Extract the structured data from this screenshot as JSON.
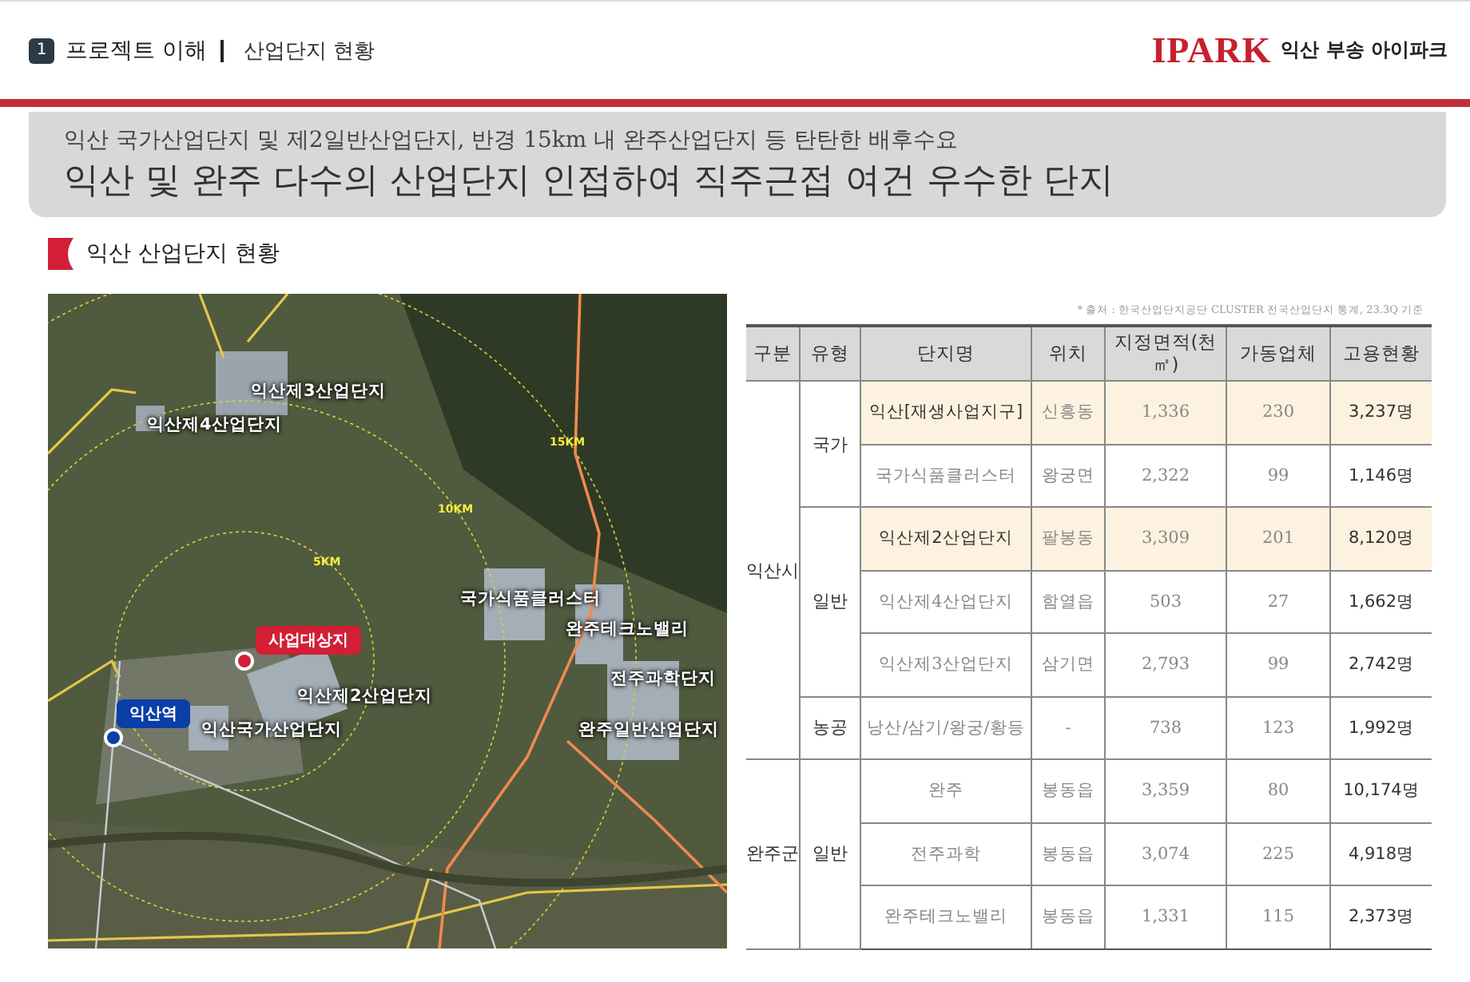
{
  "header": {
    "section_number": "1",
    "section": "프로젝트 이해",
    "page": "산업단지 현황",
    "logo": "IPARK",
    "brand": "익산 부송 아이파크"
  },
  "banner": {
    "subtitle": "익산 국가산업단지 및 제2일반산업단지, 반경 15km 내 완주산업단지 등 탄탄한 배후수요",
    "title": "익산 및 완주 다수의 산업단지 인접하여 직주근접 여건 우수한 단지"
  },
  "section_heading": "익산 산업단지 현황",
  "map": {
    "rings": [
      {
        "label": "5KM"
      },
      {
        "label": "10KM"
      },
      {
        "label": "15KM"
      }
    ],
    "labels": [
      {
        "text": "익산제3산업단지",
        "kind": "area"
      },
      {
        "text": "익산제4산업단지",
        "kind": "area"
      },
      {
        "text": "국가식품클러스터",
        "kind": "area"
      },
      {
        "text": "사업대상지",
        "kind": "site"
      },
      {
        "text": "완주테크노밸리",
        "kind": "area"
      },
      {
        "text": "전주과학단지",
        "kind": "area"
      },
      {
        "text": "익산제2산업단지",
        "kind": "area"
      },
      {
        "text": "익산역",
        "kind": "station"
      },
      {
        "text": "익산국가산업단지",
        "kind": "area"
      },
      {
        "text": "완주일반산업단지",
        "kind": "area"
      }
    ]
  },
  "table": {
    "source": "* 출처 : 한국산업단지공단 CLUSTER 전국산업단지 통계, 23.3Q 기준",
    "columns": [
      "구분",
      "유형",
      "단지명",
      "위치",
      "지정면적(천㎡)",
      "가동업체",
      "고용현황"
    ],
    "groups": [
      {
        "region": "익산시",
        "types": [
          {
            "type": "국가",
            "rows": [
              {
                "name": "익산[재생사업지구]",
                "location": "신흥동",
                "area": "1,336",
                "companies": "230",
                "employment": "3,237명",
                "highlighted": true
              },
              {
                "name": "국가식품클러스터",
                "location": "왕궁면",
                "area": "2,322",
                "companies": "99",
                "employment": "1,146명",
                "highlighted": false
              }
            ]
          },
          {
            "type": "일반",
            "rows": [
              {
                "name": "익산제2산업단지",
                "location": "팔봉동",
                "area": "3,309",
                "companies": "201",
                "employment": "8,120명",
                "highlighted": true
              },
              {
                "name": "익산제4산업단지",
                "location": "함열읍",
                "area": "503",
                "companies": "27",
                "employment": "1,662명",
                "highlighted": false
              },
              {
                "name": "익산제3산업단지",
                "location": "삼기면",
                "area": "2,793",
                "companies": "99",
                "employment": "2,742명",
                "highlighted": false
              }
            ]
          },
          {
            "type": "농공",
            "rows": [
              {
                "name": "낭산/삼기/왕궁/황등",
                "location": "-",
                "area": "738",
                "companies": "123",
                "employment": "1,992명",
                "highlighted": false
              }
            ]
          }
        ]
      },
      {
        "region": "완주군",
        "types": [
          {
            "type": "일반",
            "rows": [
              {
                "name": "완주",
                "location": "봉동읍",
                "area": "3,359",
                "companies": "80",
                "employment": "10,174명",
                "highlighted": false
              },
              {
                "name": "전주과학",
                "location": "봉동읍",
                "area": "3,074",
                "companies": "225",
                "employment": "4,918명",
                "highlighted": false
              },
              {
                "name": "완주테크노밸리",
                "location": "봉동읍",
                "area": "1,331",
                "companies": "115",
                "employment": "2,373명",
                "highlighted": false
              }
            ]
          }
        ]
      }
    ]
  }
}
